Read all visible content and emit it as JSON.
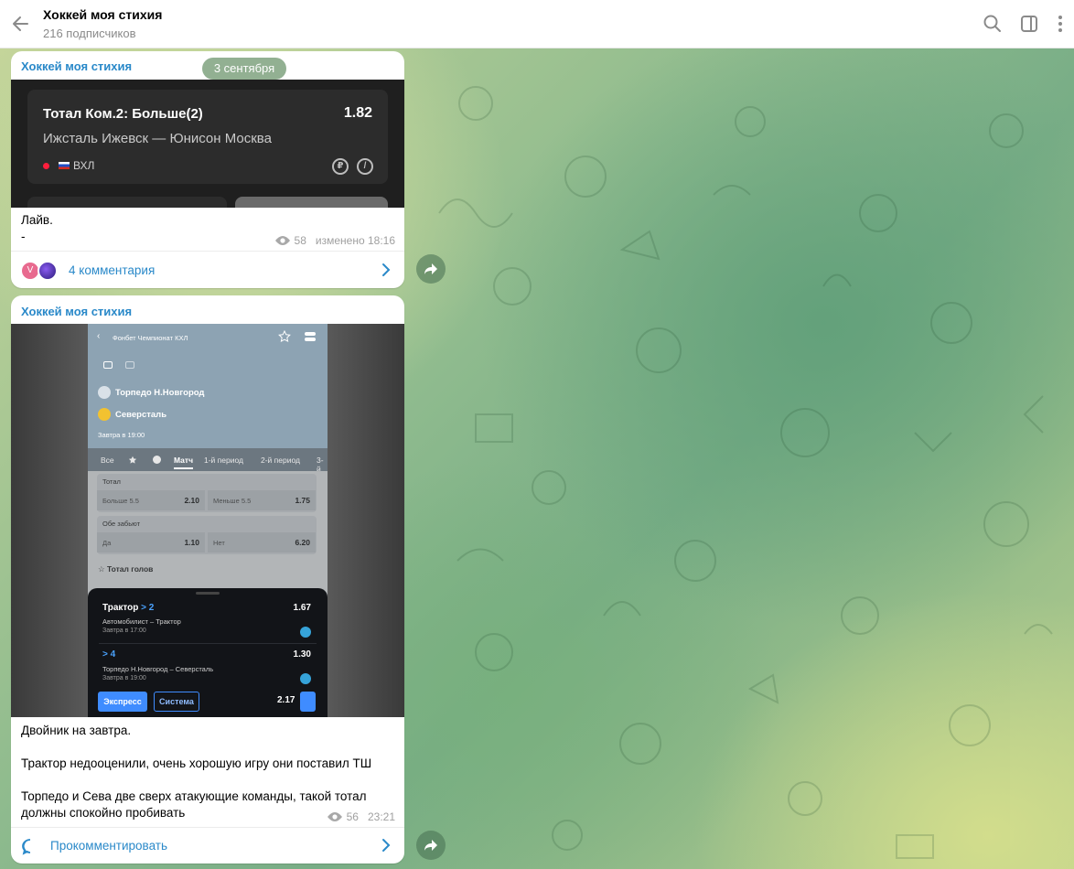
{
  "header": {
    "title": "Хоккей моя стихия",
    "subtitle": "216 подписчиков"
  },
  "date_pill": "3 сентября",
  "messages": [
    {
      "sender": "Хоккей моя стихия",
      "bet_card": {
        "title": "Тотал Ком.2: Больше(2)",
        "odds": "1.82",
        "match": "Ижсталь Ижевск — Юнисон Москва",
        "league": "ВХЛ"
      },
      "text": "Лайв.\n-",
      "views": "58",
      "edited_time": "изменено 18:16",
      "comments_label": "4 комментария",
      "avatar_letter": "V"
    },
    {
      "sender": "Хоккей моя стихия",
      "screenshot": {
        "league": "Фонбет Чемпионат КХЛ",
        "team1": "Торпедо Н.Новгород",
        "team2": "Северсталь",
        "time": "Завтра в 19:00",
        "tabs": [
          "Все",
          "Матч",
          "1-й период",
          "2-й период",
          "3-й"
        ],
        "market1": {
          "title": "Тотал",
          "left_name": "Больше 5.5",
          "left_val": "2.10",
          "right_name": "Меньше 5.5",
          "right_val": "1.75"
        },
        "market2": {
          "title": "Обе забьют",
          "left_name": "Да",
          "left_val": "1.10",
          "right_name": "Нет",
          "right_val": "6.20"
        },
        "market3_title": "Тотал голов",
        "coupon": [
          {
            "name": "Трактор",
            "hl": "> 2",
            "odds": "1.67",
            "match": "Автомобилист – Трактор",
            "time": "Завтра в 17:00"
          },
          {
            "name": "",
            "hl": "> 4",
            "odds": "1.30",
            "match": "Торпедо Н.Новгород – Северсталь",
            "time": "Завтра в 19:00"
          }
        ],
        "express_label": "Экспресс",
        "system_label": "Система",
        "total_odds": "2.17"
      },
      "text": "Двойник на завтра.\n\nТрактор недооценили, очень хорошую игру они поставил ТШ\n\nТорпедо и Сева две сверх атакующие команды, такой тотал\nдолжны спокойно пробивать",
      "views": "56",
      "time": "23:21",
      "comments_label": "Прокомментировать"
    }
  ],
  "colors": {
    "accent": "#2a89c9",
    "bubble": "#ffffff",
    "date_pill": "#6e966e"
  }
}
